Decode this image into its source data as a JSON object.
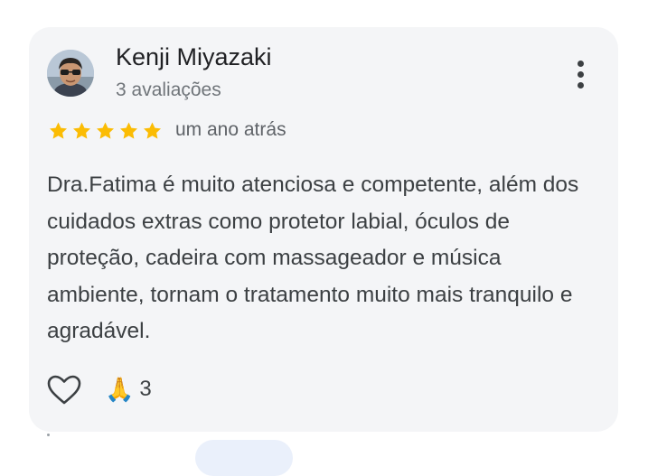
{
  "review": {
    "author_name": "Kenji Miyazaki",
    "review_count": "3 avaliações",
    "rating": 5,
    "max_rating": 5,
    "timestamp": "um ano atrás",
    "text": "Dra.Fatima é muito atenciosa e competente, além dos cuidados extras como protetor labial, óculos de proteção, cadeira com massageador e música ambiente, tornam o tratamento muito mais tranquilo e agradável.",
    "reactions": {
      "emoji": "🙏",
      "count": "3"
    }
  },
  "icons": {
    "more": "more-vert-icon",
    "like": "heart-outline-icon",
    "star": "star-icon"
  },
  "colors": {
    "card_background": "#f4f5f7",
    "star": "#fbbc04",
    "name": "#202124",
    "secondary_text": "#70757a",
    "body_text": "#3c4043"
  }
}
